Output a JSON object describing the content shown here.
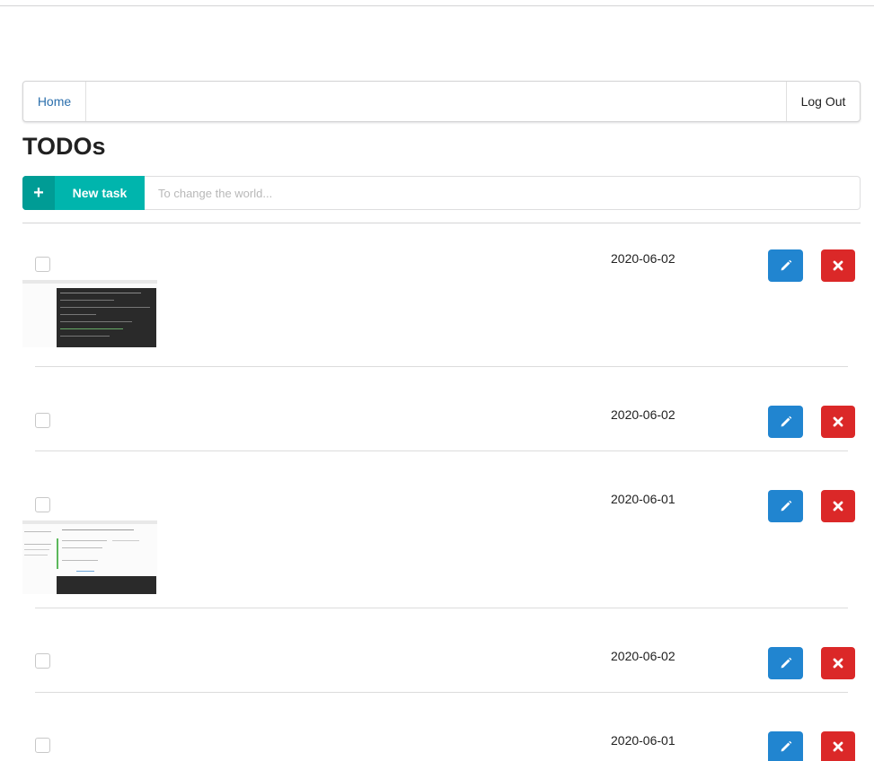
{
  "nav": {
    "home_label": "Home",
    "logout_label": "Log Out"
  },
  "page": {
    "title": "TODOs"
  },
  "new_task": {
    "button_label": "New task",
    "input_placeholder": "To change the world...",
    "input_value": ""
  },
  "icons": {
    "plus": "plus-icon",
    "edit": "pencil-icon",
    "delete": "close-icon"
  },
  "colors": {
    "teal": "#00b5ad",
    "blue": "#2185d0",
    "red": "#db2828",
    "link": "#2b6fad"
  },
  "todos": [
    {
      "date": "2020-06-02",
      "checked": false,
      "has_image": true
    },
    {
      "date": "2020-06-02",
      "checked": false,
      "has_image": false
    },
    {
      "date": "2020-06-01",
      "checked": false,
      "has_image": true
    },
    {
      "date": "2020-06-02",
      "checked": false,
      "has_image": false
    },
    {
      "date": "2020-06-01",
      "checked": false,
      "has_image": false
    }
  ]
}
